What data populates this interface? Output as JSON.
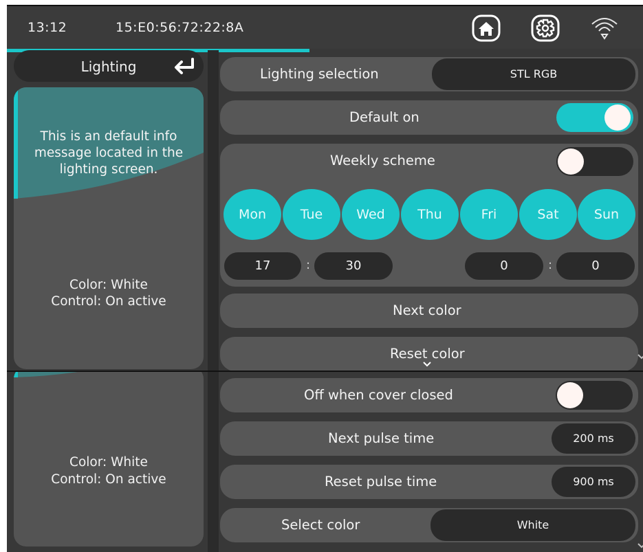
{
  "status_bar": {
    "time": "13:12",
    "device_id": "15:E0:56:72:22:8A",
    "icons": [
      "home-icon",
      "gear-icon",
      "wifi-icon"
    ]
  },
  "left_panel": {
    "title": "Lighting",
    "info_message": "This is an default info message located in the lighting screen.",
    "color_status": "Color: White",
    "control_status": "Control: On active"
  },
  "settings": {
    "lighting_selection": {
      "label": "Lighting selection",
      "value": "STL RGB"
    },
    "default_on": {
      "label": "Default on",
      "enabled": true
    },
    "weekly_scheme": {
      "label": "Weekly scheme",
      "enabled": false,
      "days": [
        "Mon",
        "Tue",
        "Wed",
        "Thu",
        "Fri",
        "Sat",
        "Sun"
      ],
      "start_hour": "17",
      "start_minute": "30",
      "end_hour": "0",
      "end_minute": "0",
      "separator": ":"
    },
    "next_color": {
      "label": "Next color"
    },
    "reset_color": {
      "label": "Reset color"
    },
    "off_when_cover_closed": {
      "label": "Off when cover closed",
      "enabled": false
    },
    "next_pulse_time": {
      "label": "Next pulse time",
      "value": "200 ms"
    },
    "reset_pulse_time": {
      "label": "Reset pulse time",
      "value": "900 ms"
    },
    "select_color": {
      "label": "Select color",
      "value": "White"
    }
  },
  "colors": {
    "accent": "#1bc6c9",
    "row_bg": "#575757",
    "pill_bg": "#2a2a2a",
    "screen_bg": "#383838"
  }
}
